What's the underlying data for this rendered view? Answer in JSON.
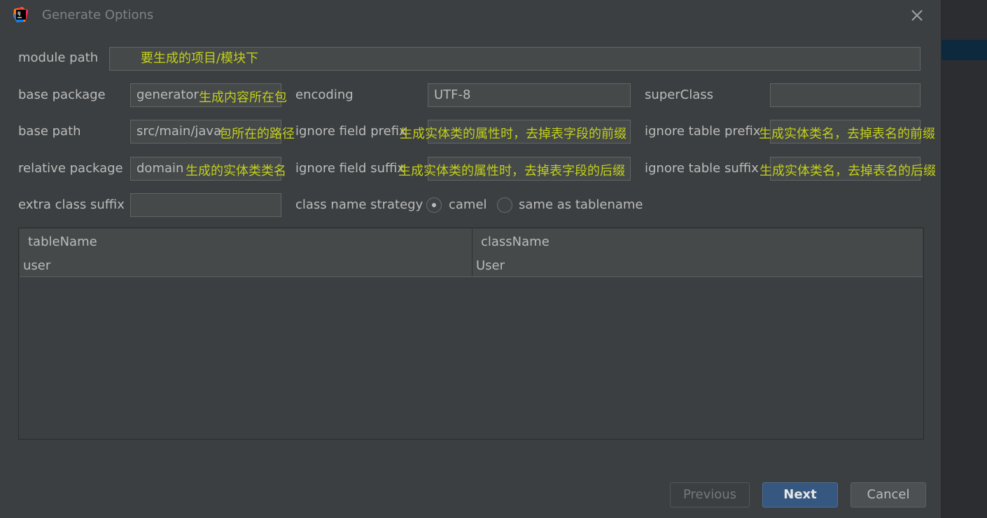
{
  "window": {
    "title": "Generate Options",
    "icon": "intellij-idea-icon"
  },
  "form": {
    "module_path": {
      "label": "module path",
      "annotation": "要生成的项目/模块下"
    },
    "base_package": {
      "label": "base package",
      "value": "generator",
      "annotation": "生成内容所在包"
    },
    "encoding": {
      "label": "encoding",
      "value": "UTF-8"
    },
    "super_class": {
      "label": "superClass",
      "value": ""
    },
    "base_path": {
      "label": "base path",
      "value": "src/main/java",
      "annotation": "包所在的路径"
    },
    "ignore_field_prefix": {
      "label": "ignore field prefix",
      "annotation": "生成实体类的属性时，去掉表字段的前缀"
    },
    "ignore_table_prefix": {
      "label": "ignore table prefix",
      "annotation": "生成实体类名，去掉表名的前缀"
    },
    "relative_package": {
      "label": "relative package",
      "value": "domain",
      "annotation": "生成的实体类类名"
    },
    "ignore_field_suffix": {
      "label": "ignore field suffix",
      "annotation": "生成实体类的属性时，去掉表字段的后缀"
    },
    "ignore_table_suffix": {
      "label": "ignore table suffix",
      "annotation": "生成实体类名，去掉表名的后缀"
    },
    "extra_class_suffix": {
      "label": "extra class suffix",
      "value": ""
    },
    "class_name_strategy": {
      "label": "class name strategy",
      "options": [
        "camel",
        "same as tablename"
      ],
      "selected": "camel"
    }
  },
  "table": {
    "columns": [
      "tableName",
      "className"
    ],
    "rows": [
      {
        "tableName": "user",
        "className": "User"
      }
    ]
  },
  "buttons": {
    "previous": "Previous",
    "next": "Next",
    "cancel": "Cancel"
  },
  "colors": {
    "annotation": "#c2cf1a",
    "primary": "#365880",
    "background": "#3c3f41"
  }
}
